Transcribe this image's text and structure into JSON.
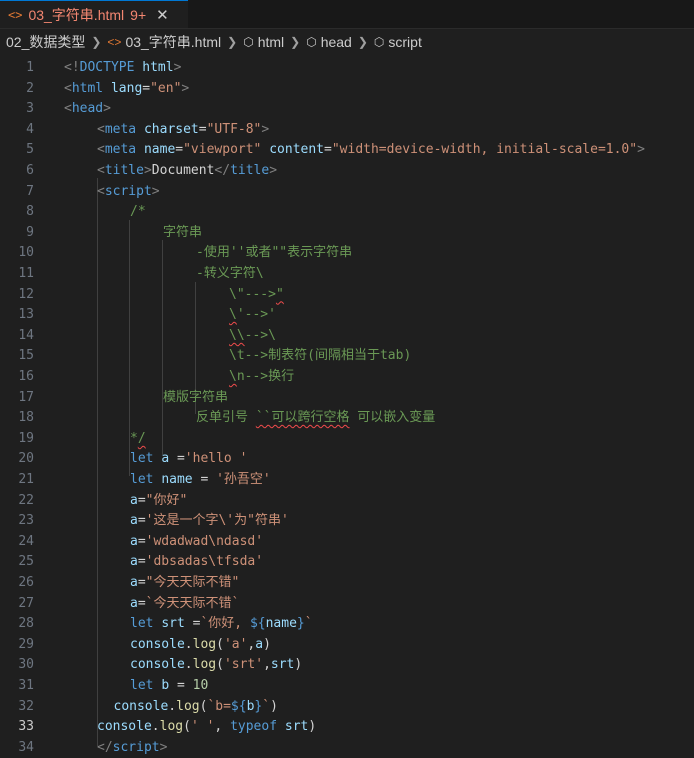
{
  "tab": {
    "icon": "<>",
    "title": "03_字符串.html",
    "modified": "9+",
    "close": "✕"
  },
  "breadcrumb": [
    {
      "label": "02_数据类型",
      "icon": ""
    },
    {
      "label": "03_字符串.html",
      "icon": "<>"
    },
    {
      "label": "html",
      "icon": "cube"
    },
    {
      "label": "head",
      "icon": "cube"
    },
    {
      "label": "script",
      "icon": "cube"
    }
  ],
  "active_line": 33,
  "lines": [
    {
      "n": "1",
      "indent": 0,
      "tokens": [
        [
          "punct",
          "<!"
        ],
        [
          "tag",
          "DOCTYPE"
        ],
        [
          "plain",
          " "
        ],
        [
          "attr",
          "html"
        ],
        [
          "punct",
          ">"
        ]
      ]
    },
    {
      "n": "2",
      "indent": 0,
      "tokens": [
        [
          "punct",
          "<"
        ],
        [
          "tag",
          "html"
        ],
        [
          "plain",
          " "
        ],
        [
          "attr",
          "lang"
        ],
        [
          "plain",
          "="
        ],
        [
          "str",
          "\"en\""
        ],
        [
          "punct",
          ">"
        ]
      ]
    },
    {
      "n": "3",
      "indent": 0,
      "tokens": [
        [
          "punct",
          "<"
        ],
        [
          "tag",
          "head"
        ],
        [
          "punct",
          ">"
        ]
      ]
    },
    {
      "n": "4",
      "indent": 1,
      "tokens": [
        [
          "punct",
          "<"
        ],
        [
          "tag",
          "meta"
        ],
        [
          "plain",
          " "
        ],
        [
          "attr",
          "charset"
        ],
        [
          "plain",
          "="
        ],
        [
          "str",
          "\"UTF-8\""
        ],
        [
          "punct",
          ">"
        ]
      ]
    },
    {
      "n": "5",
      "indent": 1,
      "tokens": [
        [
          "punct",
          "<"
        ],
        [
          "tag",
          "meta"
        ],
        [
          "plain",
          " "
        ],
        [
          "attr",
          "name"
        ],
        [
          "plain",
          "="
        ],
        [
          "str",
          "\"viewport\""
        ],
        [
          "plain",
          " "
        ],
        [
          "attr",
          "content"
        ],
        [
          "plain",
          "="
        ],
        [
          "str",
          "\"width=device-width, initial-scale=1.0\""
        ],
        [
          "punct",
          ">"
        ]
      ]
    },
    {
      "n": "6",
      "indent": 1,
      "tokens": [
        [
          "punct",
          "<"
        ],
        [
          "tag",
          "title"
        ],
        [
          "punct",
          ">"
        ],
        [
          "text",
          "Document"
        ],
        [
          "punct",
          "</"
        ],
        [
          "tag",
          "title"
        ],
        [
          "punct",
          ">"
        ]
      ]
    },
    {
      "n": "7",
      "indent": 1,
      "tokens": [
        [
          "punct",
          "<"
        ],
        [
          "tag",
          "script"
        ],
        [
          "punct",
          ">"
        ]
      ]
    },
    {
      "n": "8",
      "indent": 2,
      "tokens": [
        [
          "cmt",
          "/*"
        ]
      ]
    },
    {
      "n": "9",
      "indent": 3,
      "tokens": [
        [
          "cmt",
          "字符串"
        ]
      ]
    },
    {
      "n": "10",
      "indent": 4,
      "tokens": [
        [
          "cmt",
          "-使用''或者\"\"表示字符串"
        ]
      ]
    },
    {
      "n": "11",
      "indent": 4,
      "tokens": [
        [
          "cmt",
          "-转义字符\\"
        ]
      ]
    },
    {
      "n": "12",
      "indent": 5,
      "tokens": [
        [
          "cmt",
          "\\\"--->"
        ],
        [
          "cmtsq",
          "\""
        ]
      ]
    },
    {
      "n": "13",
      "indent": 5,
      "tokens": [
        [
          "cmtsq",
          "\\"
        ],
        [
          "cmt",
          "'-->'"
        ]
      ]
    },
    {
      "n": "14",
      "indent": 5,
      "tokens": [
        [
          "cmtsq",
          "\\\\"
        ],
        [
          "cmt",
          "-->\\"
        ]
      ]
    },
    {
      "n": "15",
      "indent": 5,
      "tokens": [
        [
          "cmt",
          "\\t-->制表符(间隔相当于tab)"
        ]
      ]
    },
    {
      "n": "16",
      "indent": 5,
      "tokens": [
        [
          "cmtsq",
          "\\"
        ],
        [
          "cmt",
          "n-->换行"
        ]
      ]
    },
    {
      "n": "17",
      "indent": 3,
      "tokens": [
        [
          "cmt",
          "模版字符串"
        ]
      ]
    },
    {
      "n": "18",
      "indent": 4,
      "tokens": [
        [
          "cmt",
          "反单引号 "
        ],
        [
          "cmtsq",
          "``可以跨行空格"
        ],
        [
          "cmt",
          " 可以嵌入变量"
        ]
      ]
    },
    {
      "n": "19",
      "indent": 2,
      "tokens": [
        [
          "cmt",
          "*"
        ],
        [
          "cmtsq",
          "/"
        ]
      ]
    },
    {
      "n": "20",
      "indent": 2,
      "tokens": [
        [
          "kw",
          "let"
        ],
        [
          "plain",
          " "
        ],
        [
          "var",
          "a"
        ],
        [
          "plain",
          " ="
        ],
        [
          "str",
          "'hello '"
        ]
      ]
    },
    {
      "n": "21",
      "indent": 2,
      "tokens": [
        [
          "kw",
          "let"
        ],
        [
          "plain",
          " "
        ],
        [
          "var",
          "name"
        ],
        [
          "plain",
          " = "
        ],
        [
          "str",
          "'孙吾空'"
        ]
      ]
    },
    {
      "n": "22",
      "indent": 2,
      "tokens": [
        [
          "var",
          "a"
        ],
        [
          "plain",
          "="
        ],
        [
          "str",
          "\"你好\""
        ]
      ]
    },
    {
      "n": "23",
      "indent": 2,
      "tokens": [
        [
          "var",
          "a"
        ],
        [
          "plain",
          "="
        ],
        [
          "str",
          "'这是一个字\\'为\"符串'"
        ]
      ]
    },
    {
      "n": "24",
      "indent": 2,
      "tokens": [
        [
          "var",
          "a"
        ],
        [
          "plain",
          "="
        ],
        [
          "str",
          "'wdadwad\\ndasd'"
        ]
      ]
    },
    {
      "n": "25",
      "indent": 2,
      "tokens": [
        [
          "var",
          "a"
        ],
        [
          "plain",
          "="
        ],
        [
          "str",
          "'dbsadas\\tfsda'"
        ]
      ]
    },
    {
      "n": "26",
      "indent": 2,
      "tokens": [
        [
          "var",
          "a"
        ],
        [
          "plain",
          "="
        ],
        [
          "str",
          "\"今天天际不错\""
        ]
      ]
    },
    {
      "n": "27",
      "indent": 2,
      "tokens": [
        [
          "var",
          "a"
        ],
        [
          "plain",
          "="
        ],
        [
          "str",
          "`今天天际不错`"
        ]
      ]
    },
    {
      "n": "28",
      "indent": 2,
      "tokens": [
        [
          "kw",
          "let"
        ],
        [
          "plain",
          " "
        ],
        [
          "var",
          "srt"
        ],
        [
          "plain",
          " ="
        ],
        [
          "str",
          "`你好, "
        ],
        [
          "kw",
          "${"
        ],
        [
          "var",
          "name"
        ],
        [
          "kw",
          "}"
        ],
        [
          "str",
          "`"
        ]
      ]
    },
    {
      "n": "29",
      "indent": 2,
      "tokens": [
        [
          "var",
          "console"
        ],
        [
          "plain",
          "."
        ],
        [
          "fn",
          "log"
        ],
        [
          "plain",
          "("
        ],
        [
          "str",
          "'a'"
        ],
        [
          "plain",
          ","
        ],
        [
          "var",
          "a"
        ],
        [
          "plain",
          ")"
        ]
      ]
    },
    {
      "n": "30",
      "indent": 2,
      "tokens": [
        [
          "var",
          "console"
        ],
        [
          "plain",
          "."
        ],
        [
          "fn",
          "log"
        ],
        [
          "plain",
          "("
        ],
        [
          "str",
          "'srt'"
        ],
        [
          "plain",
          ","
        ],
        [
          "var",
          "srt"
        ],
        [
          "plain",
          ")"
        ]
      ]
    },
    {
      "n": "31",
      "indent": 2,
      "tokens": [
        [
          "kw",
          "let"
        ],
        [
          "plain",
          " "
        ],
        [
          "var",
          "b"
        ],
        [
          "plain",
          " = "
        ],
        [
          "num",
          "10"
        ]
      ]
    },
    {
      "n": "32",
      "indent": 1.5,
      "tokens": [
        [
          "var",
          "console"
        ],
        [
          "plain",
          "."
        ],
        [
          "fn",
          "log"
        ],
        [
          "plain",
          "("
        ],
        [
          "str",
          "`b="
        ],
        [
          "kw",
          "${"
        ],
        [
          "var",
          "b"
        ],
        [
          "kw",
          "}"
        ],
        [
          "str",
          "`"
        ],
        [
          "plain",
          ")"
        ]
      ]
    },
    {
      "n": "33",
      "indent": 1,
      "tokens": [
        [
          "var",
          "console"
        ],
        [
          "plain",
          "."
        ],
        [
          "fn",
          "log"
        ],
        [
          "plain",
          "("
        ],
        [
          "str",
          "' '"
        ],
        [
          "plain",
          ", "
        ],
        [
          "kw",
          "typeof"
        ],
        [
          "plain",
          " "
        ],
        [
          "var",
          "srt"
        ],
        [
          "plain",
          ")"
        ]
      ]
    },
    {
      "n": "34",
      "indent": 1,
      "tokens": [
        [
          "punct",
          "</"
        ],
        [
          "tag",
          "script"
        ],
        [
          "punct",
          ">"
        ]
      ]
    }
  ],
  "colors": {
    "background": "#1f1f1f",
    "tag": "#569cd6",
    "attribute": "#9cdcfe",
    "string": "#ce9178",
    "comment": "#6a9955",
    "function": "#dcdcaa",
    "number": "#b5cea8",
    "tab_modified": "#f48771"
  }
}
